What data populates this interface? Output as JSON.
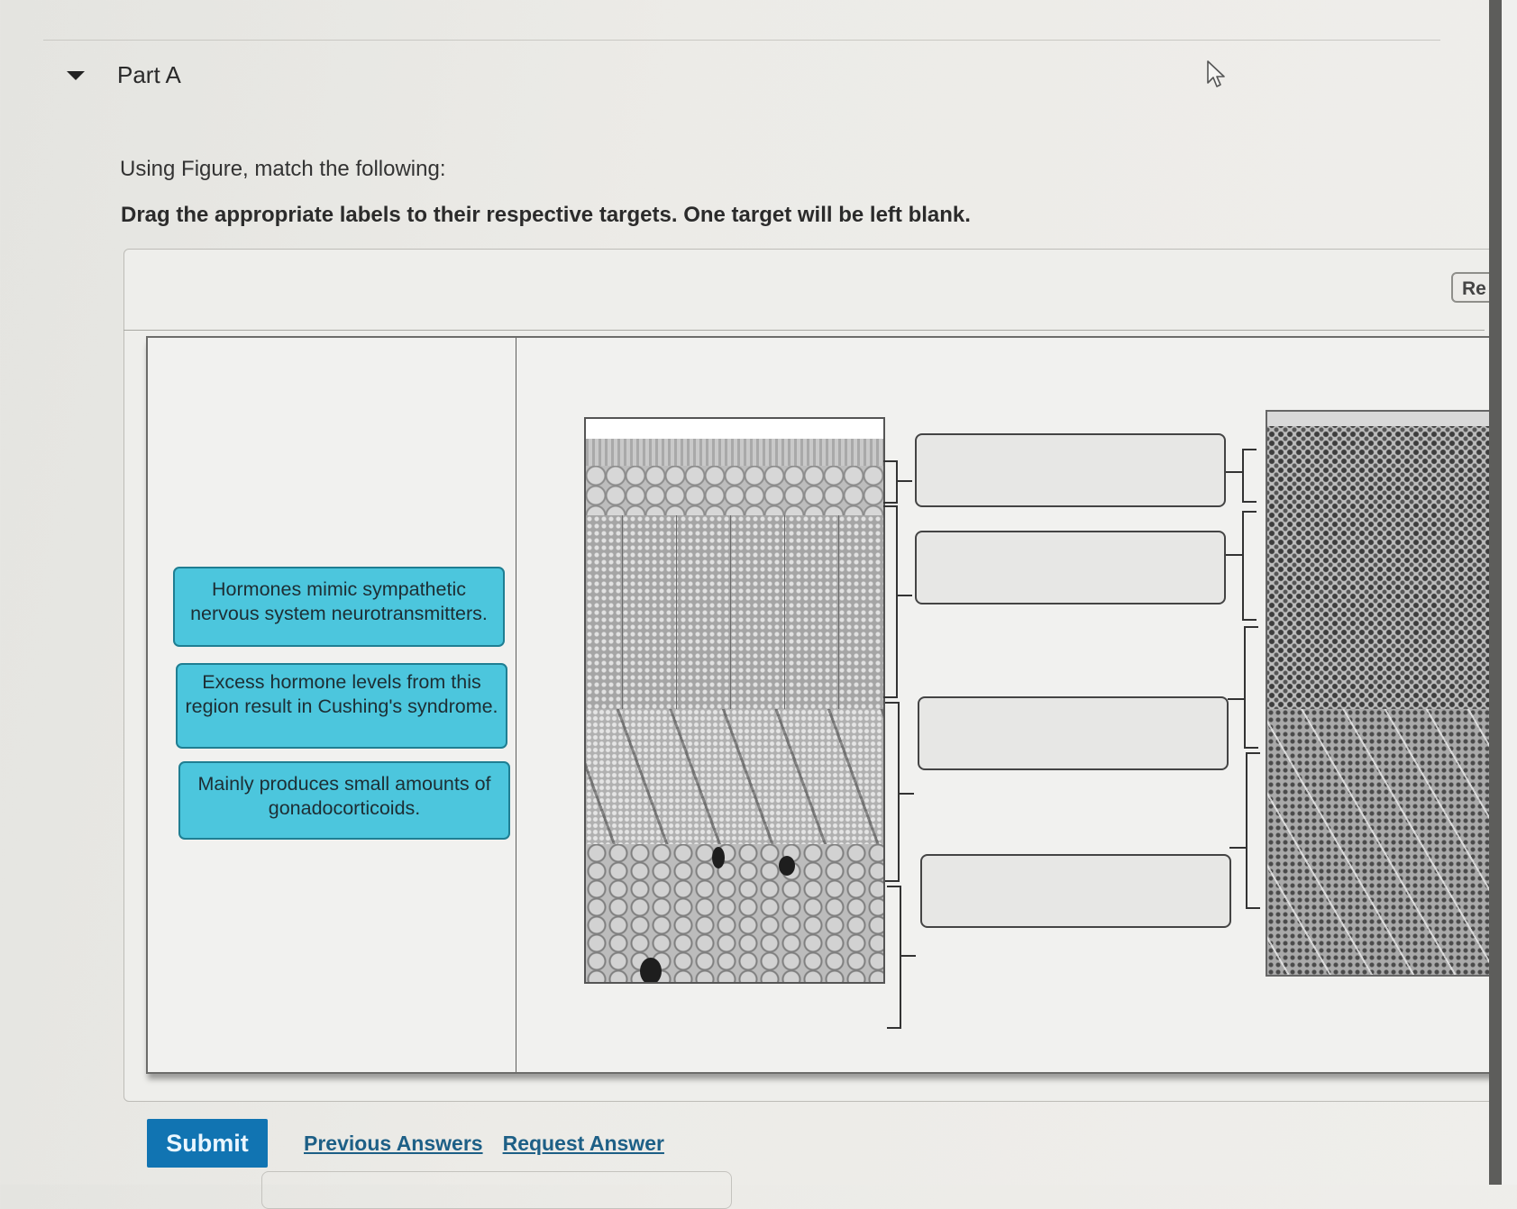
{
  "part": {
    "title": "Part A",
    "collapse_icon": "caret-down-icon"
  },
  "question": {
    "instruction": "Using Figure, match the following:",
    "drag_instruction": "Drag the appropriate labels to their respective targets. One target will be left blank."
  },
  "toolbar": {
    "reset_label": "Re"
  },
  "labels": [
    "Hormones mimic sympathetic nervous system neurotransmitters.",
    "Excess hormone levels from this region result in Cushing's syndrome.",
    "Mainly produces small amounts of gonadocorticoids."
  ],
  "targets": [
    {
      "value": ""
    },
    {
      "value": ""
    },
    {
      "value": ""
    },
    {
      "value": ""
    }
  ],
  "figures": {
    "left": "adrenal-gland-histology-drawing",
    "right": "adrenal-gland-micrograph"
  },
  "footer": {
    "submit_label": "Submit",
    "previous_answers_label": "Previous Answers",
    "request_answer_label": "Request Answer"
  }
}
